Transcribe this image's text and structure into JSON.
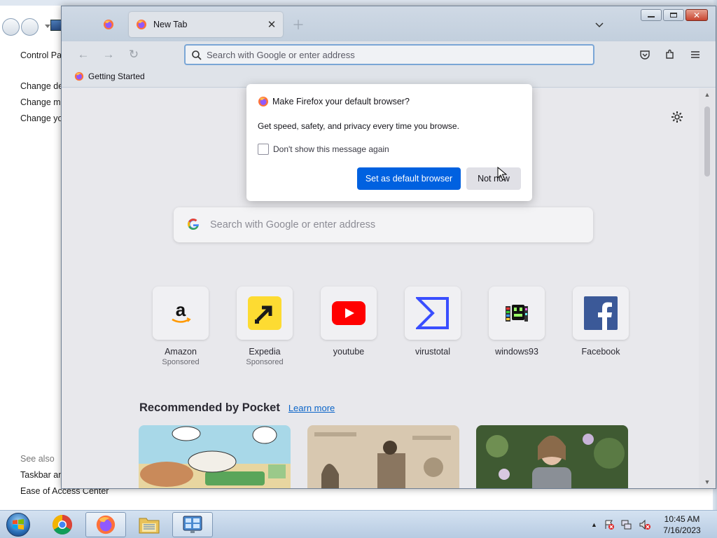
{
  "control_panel": {
    "title_fragment": "Control Par",
    "links": [
      "Change de",
      "Change mo",
      "Change yo"
    ],
    "see_also_label": "See also",
    "see_also_links": [
      "Taskbar an",
      "Ease of Access Center"
    ]
  },
  "firefox": {
    "tabs": [
      {
        "label": "New Tab",
        "active": true
      }
    ],
    "urlbar_placeholder": "Search with Google or enter address",
    "bookmarks": [
      {
        "label": "Getting Started"
      }
    ],
    "newtab": {
      "search_placeholder": "Search with Google or enter address",
      "top_sites": [
        {
          "label": "Amazon",
          "sub": "Sponsored",
          "icon": "amazon-icon"
        },
        {
          "label": "Expedia",
          "sub": "Sponsored",
          "icon": "expedia-icon"
        },
        {
          "label": "youtube",
          "sub": "",
          "icon": "youtube-icon"
        },
        {
          "label": "virustotal",
          "sub": "",
          "icon": "virustotal-icon"
        },
        {
          "label": "windows93",
          "sub": "",
          "icon": "windows93-icon"
        },
        {
          "label": "Facebook",
          "sub": "",
          "icon": "facebook-icon"
        }
      ],
      "pocket_title": "Recommended by Pocket",
      "pocket_link": "Learn more"
    }
  },
  "dialog": {
    "title": "Make Firefox your default browser?",
    "body": "Get speed, safety, and privacy every time you browse.",
    "checkbox_label": "Don't show this message again",
    "checkbox_checked": false,
    "primary_button": "Set as default browser",
    "secondary_button": "Not now"
  },
  "taskbar": {
    "time": "10:45 AM",
    "date": "7/16/2023"
  },
  "colors": {
    "primary_button": "#0061e0",
    "link": "#0a64c8"
  }
}
